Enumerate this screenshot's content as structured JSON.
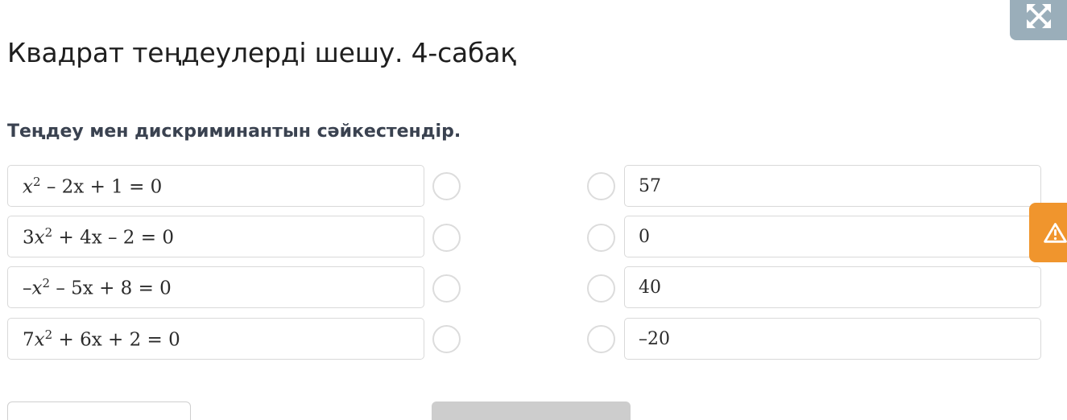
{
  "header": {
    "title": "Квадрат теңдеулерді шешу. 4-сабақ",
    "fullscreen_icon": "expand-arrows-icon"
  },
  "task": {
    "question": "Теңдеу мен дискриминантын сәйкестендір.",
    "equations": [
      {
        "coef": "",
        "prefix": "",
        "rest": " – 2x + 1 = 0"
      },
      {
        "coef": "3",
        "prefix": "",
        "rest": " + 4x – 2 = 0"
      },
      {
        "coef": "",
        "prefix": "–",
        "rest": " – 5x + 8 = 0"
      },
      {
        "coef": "7",
        "prefix": "",
        "rest": " + 6x + 2 = 0"
      }
    ],
    "answers": [
      "57",
      "0",
      "40",
      "–20"
    ]
  },
  "side": {
    "warning_icon": "warning-triangle-icon",
    "warning_color": "#f0952d"
  },
  "footer": {
    "prev_label": "",
    "check_label": ""
  },
  "colors": {
    "accent_gray": "#9aaeba",
    "border": "#d9d9d9"
  }
}
